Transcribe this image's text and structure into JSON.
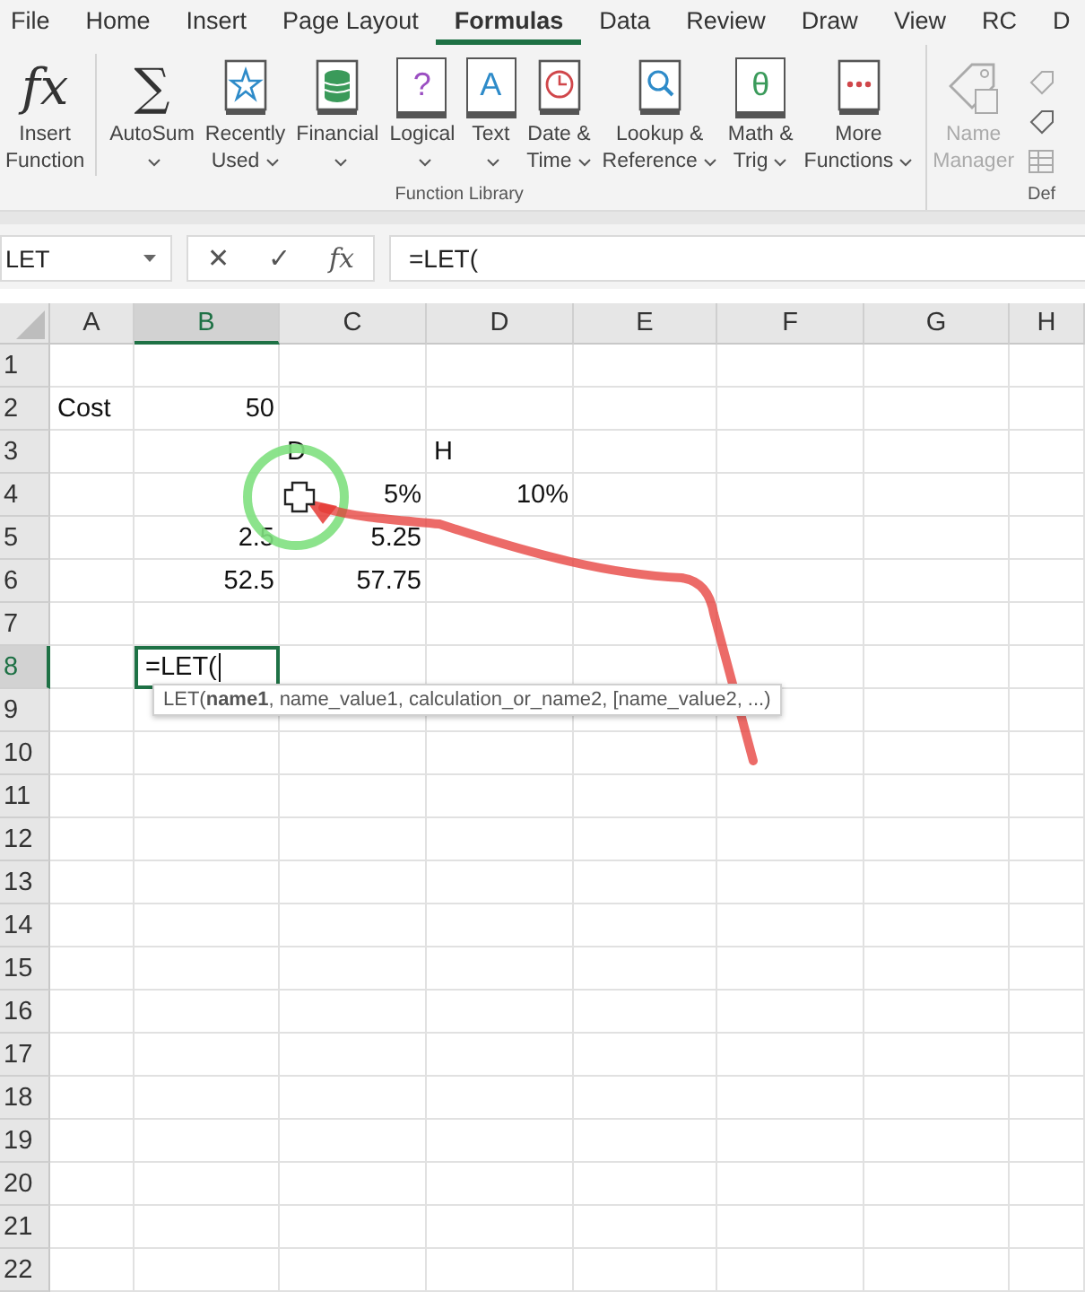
{
  "ribbon_tabs": [
    {
      "label": "File",
      "selected": false
    },
    {
      "label": "Home",
      "selected": false
    },
    {
      "label": "Insert",
      "selected": false
    },
    {
      "label": "Page Layout",
      "selected": false
    },
    {
      "label": "Formulas",
      "selected": true
    },
    {
      "label": "Data",
      "selected": false
    },
    {
      "label": "Review",
      "selected": false
    },
    {
      "label": "Draw",
      "selected": false
    },
    {
      "label": "View",
      "selected": false
    },
    {
      "label": "RC",
      "selected": false
    },
    {
      "label": "D",
      "selected": false
    }
  ],
  "ribbon": {
    "groups": [
      {
        "label": "Function Library",
        "buttons": [
          {
            "lines": [
              "Insert",
              "Function"
            ],
            "symbol": "fx",
            "has_menu": false,
            "disabled": false
          },
          {
            "lines": [
              "AutoSum"
            ],
            "symbol": "∑",
            "has_menu": true,
            "disabled": false
          },
          {
            "lines": [
              "Recently",
              "Used"
            ],
            "has_menu": true,
            "disabled": false
          },
          {
            "lines": [
              "Financial"
            ],
            "has_menu": true,
            "disabled": false
          },
          {
            "lines": [
              "Logical"
            ],
            "symbol": "?",
            "has_menu": true,
            "disabled": false
          },
          {
            "lines": [
              "Text"
            ],
            "symbol": "A",
            "has_menu": true,
            "disabled": false
          },
          {
            "lines": [
              "Date &",
              "Time"
            ],
            "has_menu": true,
            "disabled": false
          },
          {
            "lines": [
              "Lookup &",
              "Reference"
            ],
            "has_menu": true,
            "disabled": false
          },
          {
            "lines": [
              "Math &",
              "Trig"
            ],
            "symbol": "θ",
            "has_menu": true,
            "disabled": false
          },
          {
            "lines": [
              "More",
              "Functions"
            ],
            "has_menu": true,
            "disabled": false
          }
        ]
      },
      {
        "label": "Def",
        "buttons": [
          {
            "lines": [
              "Name",
              "Manager"
            ],
            "has_menu": false,
            "disabled": true
          }
        ]
      }
    ]
  },
  "formula_bar": {
    "name_box": "LET",
    "cancel": "✕",
    "enter": "✓",
    "function_symbol": "fx",
    "value": "=LET("
  },
  "columns": [
    {
      "label": "A",
      "selected": false
    },
    {
      "label": "B",
      "selected": true
    },
    {
      "label": "C",
      "selected": false
    },
    {
      "label": "D",
      "selected": false
    },
    {
      "label": "E",
      "selected": false
    },
    {
      "label": "F",
      "selected": false
    },
    {
      "label": "G",
      "selected": false
    },
    {
      "label": "H",
      "selected": false
    }
  ],
  "rows": [
    {
      "header": "1",
      "selected": false,
      "cells": {}
    },
    {
      "header": "2",
      "selected": false,
      "cells": {
        "col_a": {
          "text": "Cost",
          "kind": "label"
        },
        "col_b": {
          "text": "50",
          "kind": "number"
        }
      }
    },
    {
      "header": "3",
      "selected": false,
      "cells": {
        "col_c": {
          "text": "D",
          "kind": "label"
        },
        "col_d": {
          "text": "H",
          "kind": "label"
        }
      }
    },
    {
      "header": "4",
      "selected": false,
      "cells": {
        "col_c": {
          "text": "5%",
          "kind": "number"
        },
        "col_d": {
          "text": "10%",
          "kind": "number"
        }
      }
    },
    {
      "header": "5",
      "selected": false,
      "cells": {
        "col_b": {
          "text": "2.5",
          "kind": "number"
        },
        "col_c": {
          "text": "5.25",
          "kind": "number"
        }
      }
    },
    {
      "header": "6",
      "selected": false,
      "cells": {
        "col_b": {
          "text": "52.5",
          "kind": "number"
        },
        "col_c": {
          "text": "57.75",
          "kind": "number"
        }
      }
    },
    {
      "header": "7",
      "selected": false,
      "cells": {}
    },
    {
      "header": "8",
      "selected": true,
      "cells": {
        "col_b": {
          "text": "=LET(",
          "kind": "label",
          "editing": true
        }
      }
    },
    {
      "header": "9",
      "selected": false,
      "cells": {}
    },
    {
      "header": "10",
      "selected": false,
      "cells": {}
    },
    {
      "header": "11",
      "selected": false,
      "cells": {}
    },
    {
      "header": "12",
      "selected": false,
      "cells": {}
    },
    {
      "header": "13",
      "selected": false,
      "cells": {}
    },
    {
      "header": "14",
      "selected": false,
      "cells": {}
    },
    {
      "header": "15",
      "selected": false,
      "cells": {}
    },
    {
      "header": "16",
      "selected": false,
      "cells": {}
    },
    {
      "header": "17",
      "selected": false,
      "cells": {}
    },
    {
      "header": "18",
      "selected": false,
      "cells": {}
    },
    {
      "header": "19",
      "selected": false,
      "cells": {}
    },
    {
      "header": "20",
      "selected": false,
      "cells": {}
    },
    {
      "header": "21",
      "selected": false,
      "cells": {}
    },
    {
      "header": "22",
      "selected": false,
      "cells": {}
    }
  ],
  "tooltip": "LET(**name1**, name_value1, calculation_or_name2, [name_value2, ...)"
}
